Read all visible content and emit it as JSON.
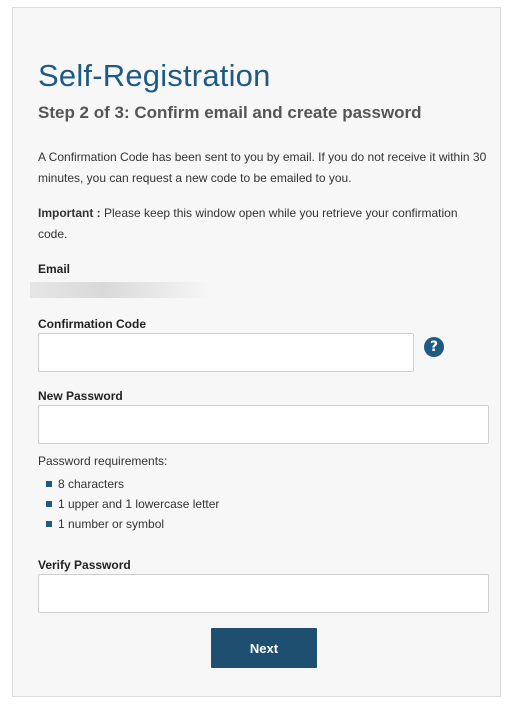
{
  "page": {
    "title": "Self-Registration",
    "subtitle": "Step 2 of 3: Confirm email and create password"
  },
  "info": {
    "confirmation_message": "A Confirmation Code has been sent to you by email. If you do not receive it within 30 minutes, you can request a new code to be emailed to you.",
    "important_label": "Important :",
    "important_message": " Please keep this window open while you retrieve your confirmation code."
  },
  "form": {
    "email_label": "Email",
    "confirmation_code_label": "Confirmation Code",
    "confirmation_code_value": "",
    "help_icon": "question-circle-icon",
    "help_glyph": "?",
    "new_password_label": "New Password",
    "new_password_value": "",
    "password_requirements_title": "Password requirements:",
    "password_requirements": [
      "8 characters",
      "1 upper and 1 lowercase letter",
      "1 number or symbol"
    ],
    "verify_password_label": "Verify Password",
    "verify_password_value": "",
    "next_button_label": "Next"
  },
  "colors": {
    "accent": "#1f5a84",
    "button": "#1f4f70",
    "card_background": "#f7f7f7"
  }
}
